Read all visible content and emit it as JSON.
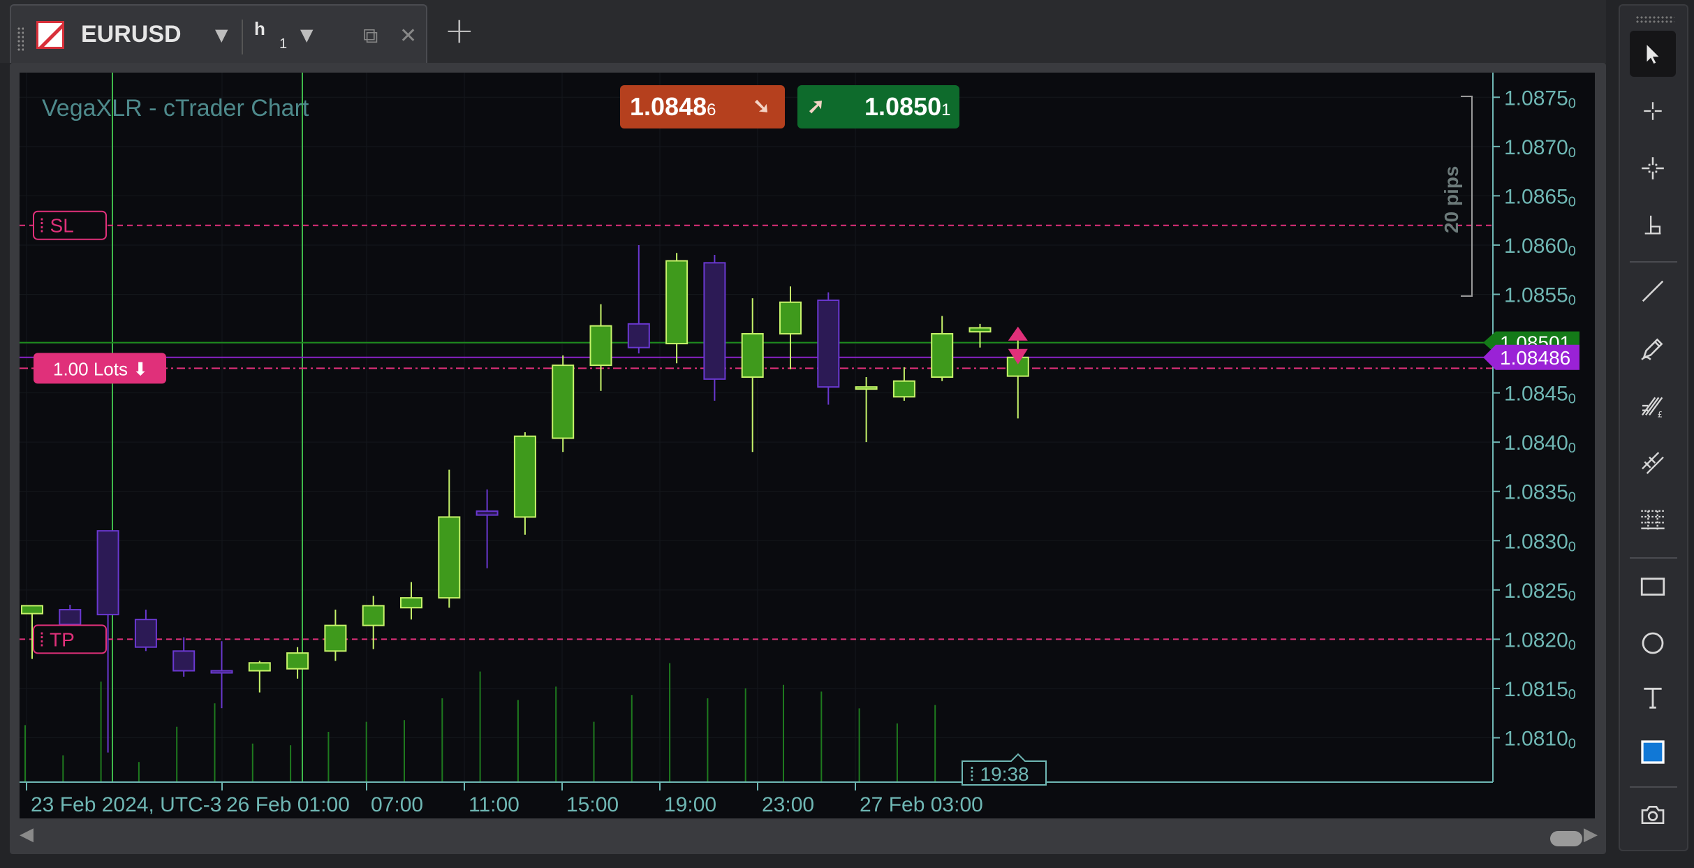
{
  "tab": {
    "symbol": "EURUSD",
    "timeframe": "h",
    "timeframe_num": "1"
  },
  "chart": {
    "title": "VegaXLR - cTrader Chart",
    "sell_price_main": "1.0848",
    "sell_price_sub": "6",
    "buy_price_main": "1.0850",
    "buy_price_sub": "1",
    "sl_label": "SL",
    "tp_label": "TP",
    "lots_label": "1.00 Lots",
    "pips_label": "20 pips",
    "ask_tag": "1.08501",
    "bid_tag": "1.08486",
    "time_cursor": "19:38",
    "colors": {
      "background": "#0a0b0f",
      "bull": "#3f9a1c",
      "bull_border": "#c6f36a",
      "bear": "#2c1a55",
      "bear_border": "#6a38d0",
      "sl_tp": "#e0307a",
      "axis": "#6fb7b4",
      "ask_line": "#1d8c1d",
      "bid_line": "#8a22c8"
    },
    "y_ticks": [
      "1.0875",
      "1.0870",
      "1.0865",
      "1.0860",
      "1.0855",
      "1.0850",
      "1.0845",
      "1.0840",
      "1.0835",
      "1.0830",
      "1.0825",
      "1.0820",
      "1.0815",
      "1.0810"
    ],
    "x_ticks": [
      "23 Feb 2024, UTC-3",
      "26 Feb 01:00",
      "07:00",
      "11:00",
      "15:00",
      "19:00",
      "23:00",
      "27 Feb 03:00"
    ]
  },
  "chart_data": {
    "type": "candlestick",
    "symbol": "EURUSD",
    "timeframe": "h1",
    "ylim": [
      1.08055,
      1.08775
    ],
    "sl": 1.0862,
    "tp": 1.082,
    "ask": 1.08501,
    "bid": 1.08486,
    "entry": 1.08475,
    "candles": [
      {
        "o": 1.08226,
        "h": 1.08234,
        "l": 1.0818,
        "c": 1.08234
      },
      {
        "o": 1.0823,
        "h": 1.08235,
        "l": 1.082,
        "c": 1.08215
      },
      {
        "o": 1.0831,
        "h": 1.0831,
        "l": 1.08085,
        "c": 1.08225
      },
      {
        "o": 1.0822,
        "h": 1.0823,
        "l": 1.08188,
        "c": 1.08192
      },
      {
        "o": 1.08188,
        "h": 1.08202,
        "l": 1.08162,
        "c": 1.08168
      },
      {
        "o": 1.08168,
        "h": 1.08198,
        "l": 1.0813,
        "c": 1.08166
      },
      {
        "o": 1.08168,
        "h": 1.08178,
        "l": 1.08146,
        "c": 1.08176
      },
      {
        "o": 1.0817,
        "h": 1.08192,
        "l": 1.0816,
        "c": 1.08186
      },
      {
        "o": 1.08188,
        "h": 1.0823,
        "l": 1.08178,
        "c": 1.08214
      },
      {
        "o": 1.08214,
        "h": 1.08244,
        "l": 1.0819,
        "c": 1.08234
      },
      {
        "o": 1.08232,
        "h": 1.08258,
        "l": 1.0822,
        "c": 1.08242
      },
      {
        "o": 1.08242,
        "h": 1.08372,
        "l": 1.08232,
        "c": 1.08324
      },
      {
        "o": 1.0833,
        "h": 1.08352,
        "l": 1.08272,
        "c": 1.08326
      },
      {
        "o": 1.08324,
        "h": 1.0841,
        "l": 1.08306,
        "c": 1.08406
      },
      {
        "o": 1.08404,
        "h": 1.08488,
        "l": 1.0839,
        "c": 1.08478
      },
      {
        "o": 1.08478,
        "h": 1.0854,
        "l": 1.08452,
        "c": 1.08518
      },
      {
        "o": 1.0852,
        "h": 1.086,
        "l": 1.0849,
        "c": 1.08496
      },
      {
        "o": 1.085,
        "h": 1.08592,
        "l": 1.0848,
        "c": 1.08584
      },
      {
        "o": 1.08582,
        "h": 1.0859,
        "l": 1.08442,
        "c": 1.08464
      },
      {
        "o": 1.08466,
        "h": 1.08546,
        "l": 1.0839,
        "c": 1.0851
      },
      {
        "o": 1.0851,
        "h": 1.08558,
        "l": 1.08474,
        "c": 1.08542
      },
      {
        "o": 1.08544,
        "h": 1.08552,
        "l": 1.08438,
        "c": 1.08456
      },
      {
        "o": 1.08456,
        "h": 1.08466,
        "l": 1.084,
        "c": 1.08456
      },
      {
        "o": 1.08446,
        "h": 1.08476,
        "l": 1.08442,
        "c": 1.08462
      },
      {
        "o": 1.08466,
        "h": 1.08528,
        "l": 1.08462,
        "c": 1.0851
      },
      {
        "o": 1.08512,
        "h": 1.0852,
        "l": 1.08496,
        "c": 1.08516
      },
      {
        "o": 1.08467,
        "h": 1.08505,
        "l": 1.08424,
        "c": 1.08486
      }
    ],
    "volumes": [
      0.34,
      0.16,
      0.6,
      0.12,
      0.33,
      0.47,
      0.23,
      0.22,
      0.3,
      0.36,
      0.37,
      0.5,
      0.66,
      0.49,
      0.57,
      0.36,
      0.52,
      0.71,
      0.5,
      0.56,
      0.58,
      0.54,
      0.44,
      0.35,
      0.46,
      0.12,
      0.05
    ]
  },
  "toolbar": {
    "tools": [
      "cursor-icon",
      "crosshair-icon",
      "crosshair-plus-icon",
      "measure-icon",
      "line-icon",
      "pencil-icon",
      "fibonacci-icon",
      "channel-icon",
      "grid-icon",
      "rectangle-icon",
      "circle-icon",
      "text-icon",
      "color-icon",
      "camera-icon"
    ]
  }
}
